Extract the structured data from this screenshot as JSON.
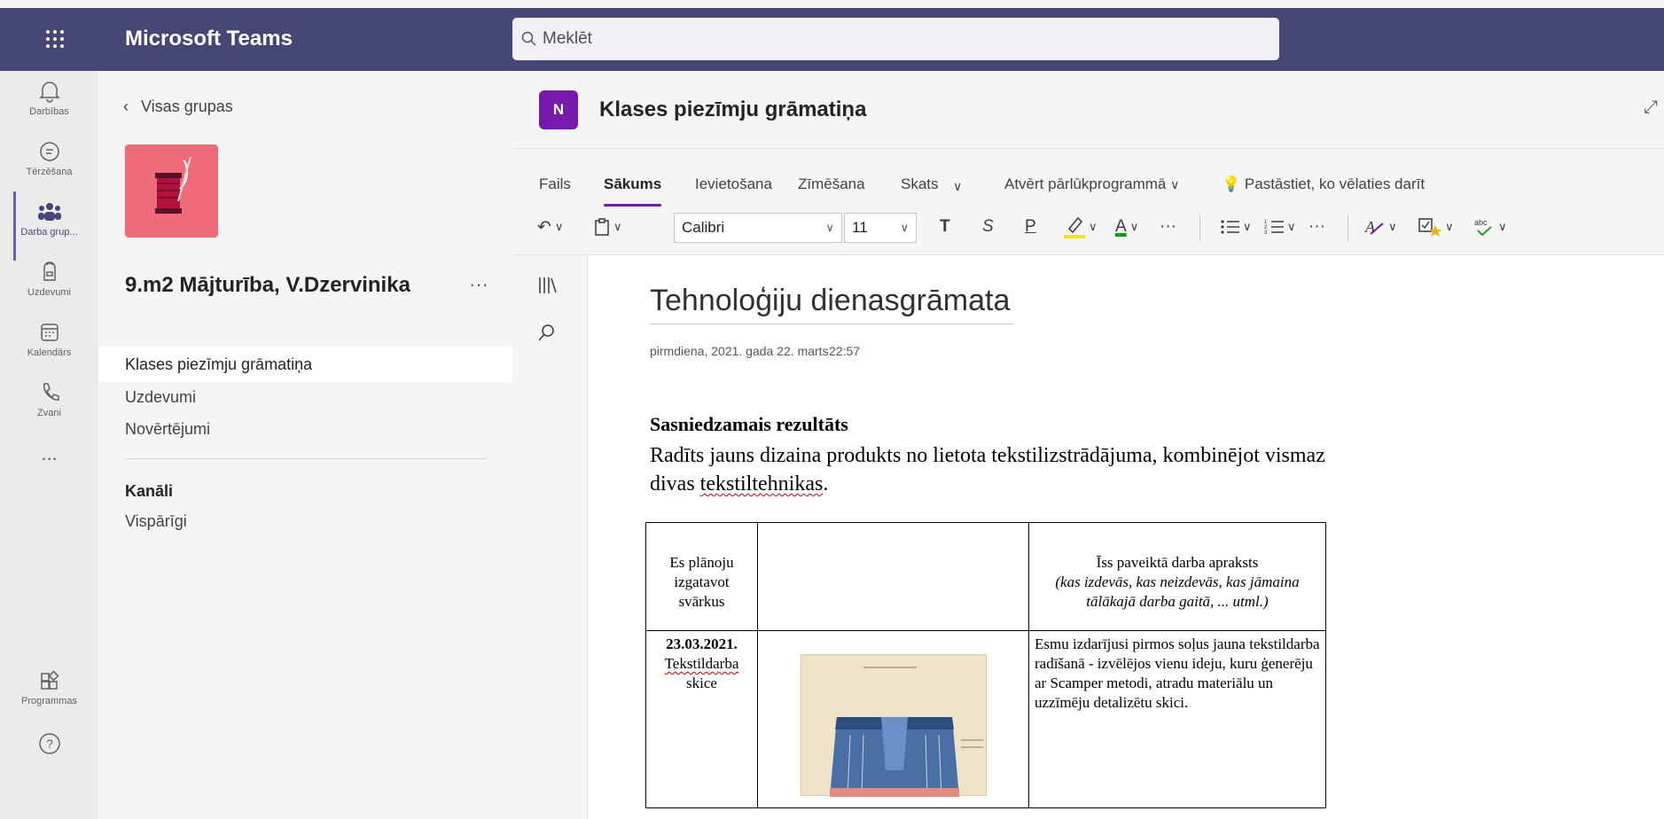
{
  "app": {
    "title": "Microsoft Teams",
    "search_placeholder": "Meklēt"
  },
  "rail": [
    {
      "label": "Darbības",
      "icon": "bell-icon"
    },
    {
      "label": "Tērzēšana",
      "icon": "chat-icon"
    },
    {
      "label": "Darba grup...",
      "icon": "teams-icon",
      "active": true
    },
    {
      "label": "Uzdevumi",
      "icon": "backpack-icon"
    },
    {
      "label": "Kalendārs",
      "icon": "calendar-icon"
    },
    {
      "label": "Zvani",
      "icon": "phone-icon"
    },
    {
      "label": "...",
      "icon": "more-icon"
    },
    {
      "label": "Programmas",
      "icon": "apps-icon"
    },
    {
      "label": "?",
      "icon": "help-icon"
    }
  ],
  "channels": {
    "back_label": "Visas grupas",
    "team_name": "9.m2 Mājturība, V.Dzervinika",
    "more": "···",
    "items": [
      "Klases piezīmju grāmatiņa",
      "Uzdevumi",
      "Novērtējumi"
    ],
    "section_label": "Kanāli",
    "channel": "Vispārīgi"
  },
  "onenote": {
    "logo": "N",
    "title": "Klases piezīmju grāmatiņa",
    "tabs": [
      "Fails",
      "Sākums",
      "Ievietošana",
      "Zīmēšana",
      "Skats",
      "Atvērt pārlūkprogrammā",
      "Pastāstiet, ko vēlaties darīt"
    ],
    "font": "Calibri",
    "size": "11",
    "bold": "T",
    "italic": "S",
    "underline": "P",
    "more": "···"
  },
  "page": {
    "title": "Tehnoloģiju dienasgrāmata",
    "date": "pirmdiena, 2021. gada 22. marts",
    "time": "22:57",
    "heading": "Sasniedzamais rezultāts",
    "para_a": "Radīts jauns dizaina produkts no lietota tekstilizstrādājuma, kombinējot vismaz divas ",
    "para_b": "tekstiltehnikas",
    "para_c": ".",
    "table": {
      "h1": "Es plānoju izgatavot svārkus",
      "h3_a": "Īss paveiktā darba apraksts",
      "h3_b": "(kas izdevās, kas neizdevās, kas jāmaina tālākajā darba gaitā, ... utml.)",
      "r_date": "23.03.2021.",
      "r_title_a": "Tekstildarba",
      "r_title_b": "skice",
      "r_desc": "Esmu izdarījusi pirmos soļus jauna tekstildarba radīšanā - izvēlējos vienu ideju, kuru ģenerēju ar Scamper metodi, atradu materiālu un uzzīmēju detalizētu skici."
    }
  }
}
